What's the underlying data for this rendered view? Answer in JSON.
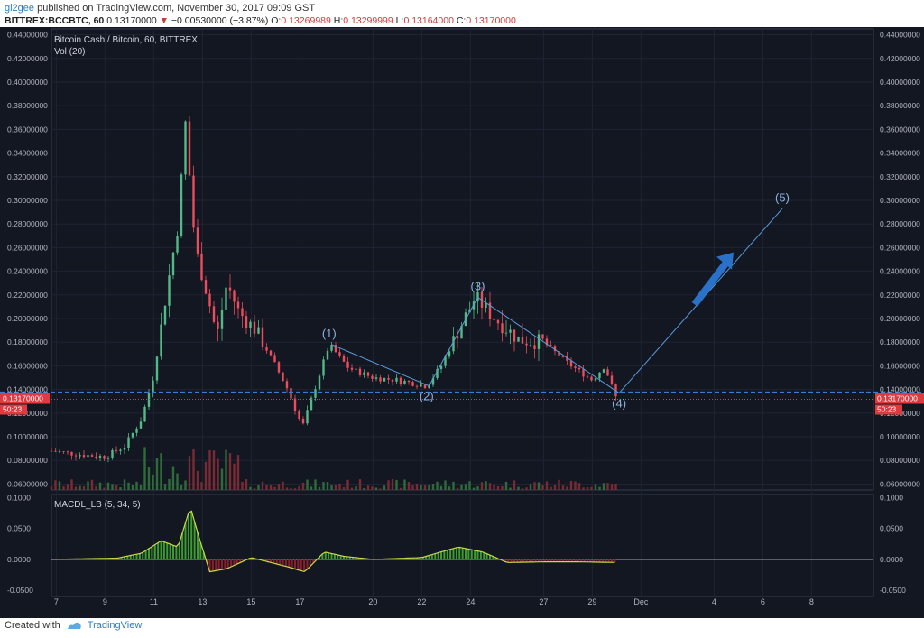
{
  "header": {
    "user": "gi2gee",
    "published": "published on TradingView.com, November 30, 2017 09:09 GST",
    "symbol": "BITTREX:BCCBTC, 60",
    "last": "0.13170000",
    "change_arrow": "▼",
    "change": "−0.00530000 (−3.87%)",
    "o_label": "O:",
    "o": "0.13269989",
    "h_label": "H:",
    "h": "0.13299999",
    "l_label": "L:",
    "l": "0.13164000",
    "c_label": "C:",
    "c": "0.13170000"
  },
  "footer": {
    "created": "Created with",
    "brand": "TradingView"
  },
  "chart_data": [
    {
      "type": "candlestick",
      "title": "Bitcoin Cash / Bitcoin, 60, BITTREX",
      "indicator_label": "Vol (20)",
      "y_ticks": [
        "0.44000000",
        "0.42000000",
        "0.40000000",
        "0.38000000",
        "0.36000000",
        "0.34000000",
        "0.32000000",
        "0.30000000",
        "0.28000000",
        "0.26000000",
        "0.24000000",
        "0.22000000",
        "0.20000000",
        "0.18000000",
        "0.16000000",
        "0.14000000",
        "0.12000000",
        "0.10000000",
        "0.08000000",
        "0.06000000"
      ],
      "ylim": [
        0.055,
        0.445
      ],
      "x_ticks": [
        "7",
        "9",
        "11",
        "13",
        "15",
        "17",
        "20",
        "22",
        "24",
        "27",
        "29",
        "Dec",
        "4",
        "6",
        "8"
      ],
      "price_line": {
        "label": "0.13170000",
        "value": 0.1317,
        "color": "#e0393e"
      },
      "countdown": "50:23",
      "support_level": 0.1375,
      "price_path": [
        {
          "d": 6.8,
          "v": 0.088
        },
        {
          "d": 8.0,
          "v": 0.085
        },
        {
          "d": 9.0,
          "v": 0.083
        },
        {
          "d": 9.8,
          "v": 0.092
        },
        {
          "d": 10.5,
          "v": 0.115
        },
        {
          "d": 11.0,
          "v": 0.152
        },
        {
          "d": 11.5,
          "v": 0.22
        },
        {
          "d": 12.0,
          "v": 0.28
        },
        {
          "d": 12.3,
          "v": 0.365
        },
        {
          "d": 12.7,
          "v": 0.26
        },
        {
          "d": 13.2,
          "v": 0.22
        },
        {
          "d": 13.6,
          "v": 0.185
        },
        {
          "d": 14.0,
          "v": 0.23
        },
        {
          "d": 14.5,
          "v": 0.205
        },
        {
          "d": 15.2,
          "v": 0.19
        },
        {
          "d": 16.0,
          "v": 0.16
        },
        {
          "d": 16.5,
          "v": 0.14
        },
        {
          "d": 17.1,
          "v": 0.108
        },
        {
          "d": 17.6,
          "v": 0.14
        },
        {
          "d": 18.2,
          "v": 0.178
        },
        {
          "d": 19.0,
          "v": 0.158
        },
        {
          "d": 20.0,
          "v": 0.15
        },
        {
          "d": 21.0,
          "v": 0.148
        },
        {
          "d": 22.2,
          "v": 0.143
        },
        {
          "d": 22.8,
          "v": 0.16
        },
        {
          "d": 23.5,
          "v": 0.19
        },
        {
          "d": 24.2,
          "v": 0.218
        },
        {
          "d": 25.0,
          "v": 0.2
        },
        {
          "d": 26.0,
          "v": 0.182
        },
        {
          "d": 27.0,
          "v": 0.18
        },
        {
          "d": 28.0,
          "v": 0.162
        },
        {
          "d": 29.0,
          "v": 0.148
        },
        {
          "d": 29.5,
          "v": 0.16
        },
        {
          "d": 30.0,
          "v": 0.1317
        }
      ],
      "wave_lines": [
        {
          "from": {
            "d": 18.3,
            "v": 0.178
          },
          "to": {
            "d": 22.3,
            "v": 0.143
          }
        },
        {
          "from": {
            "d": 22.3,
            "v": 0.143
          },
          "to": {
            "d": 24.3,
            "v": 0.218
          }
        },
        {
          "from": {
            "d": 24.3,
            "v": 0.218
          },
          "to": {
            "d": 30.1,
            "v": 0.137
          }
        },
        {
          "from": {
            "d": 30.1,
            "v": 0.137
          },
          "to": {
            "d": 36.8,
            "v": 0.293
          }
        }
      ],
      "wave_labels": [
        {
          "text": "(1)",
          "d": 18.2,
          "v": 0.184
        },
        {
          "text": "(2)",
          "d": 22.2,
          "v": 0.131
        },
        {
          "text": "(3)",
          "d": 24.3,
          "v": 0.224
        },
        {
          "text": "(4)",
          "d": 30.1,
          "v": 0.125
        },
        {
          "text": "(5)",
          "d": 36.8,
          "v": 0.299
        }
      ],
      "arrow": {
        "color": "#2a72c9",
        "from": {
          "d": 33.2,
          "v": 0.212
        },
        "to": {
          "d": 34.8,
          "v": 0.256
        }
      }
    },
    {
      "type": "histogram",
      "title": "MACDL_LB (5, 34, 5)",
      "y_ticks": [
        "0.1000",
        "0.0500",
        "0.0000",
        "-0.0500"
      ],
      "ylim": [
        -0.06,
        0.105
      ],
      "hist": [
        {
          "d": 6.8,
          "v": 0.0
        },
        {
          "d": 9.5,
          "v": 0.002
        },
        {
          "d": 10.5,
          "v": 0.01
        },
        {
          "d": 11.3,
          "v": 0.03
        },
        {
          "d": 12.0,
          "v": 0.02
        },
        {
          "d": 12.5,
          "v": 0.085
        },
        {
          "d": 12.9,
          "v": 0.03
        },
        {
          "d": 13.3,
          "v": -0.02
        },
        {
          "d": 14.0,
          "v": -0.015
        },
        {
          "d": 15.0,
          "v": 0.003
        },
        {
          "d": 16.5,
          "v": -0.012
        },
        {
          "d": 17.2,
          "v": -0.02
        },
        {
          "d": 18.0,
          "v": 0.012
        },
        {
          "d": 18.8,
          "v": 0.005
        },
        {
          "d": 20.0,
          "v": 0.0
        },
        {
          "d": 22.0,
          "v": 0.003
        },
        {
          "d": 23.5,
          "v": 0.02
        },
        {
          "d": 24.5,
          "v": 0.012
        },
        {
          "d": 25.5,
          "v": -0.005
        },
        {
          "d": 27.0,
          "v": -0.004
        },
        {
          "d": 28.5,
          "v": -0.004
        },
        {
          "d": 30.0,
          "v": -0.005
        }
      ]
    }
  ]
}
